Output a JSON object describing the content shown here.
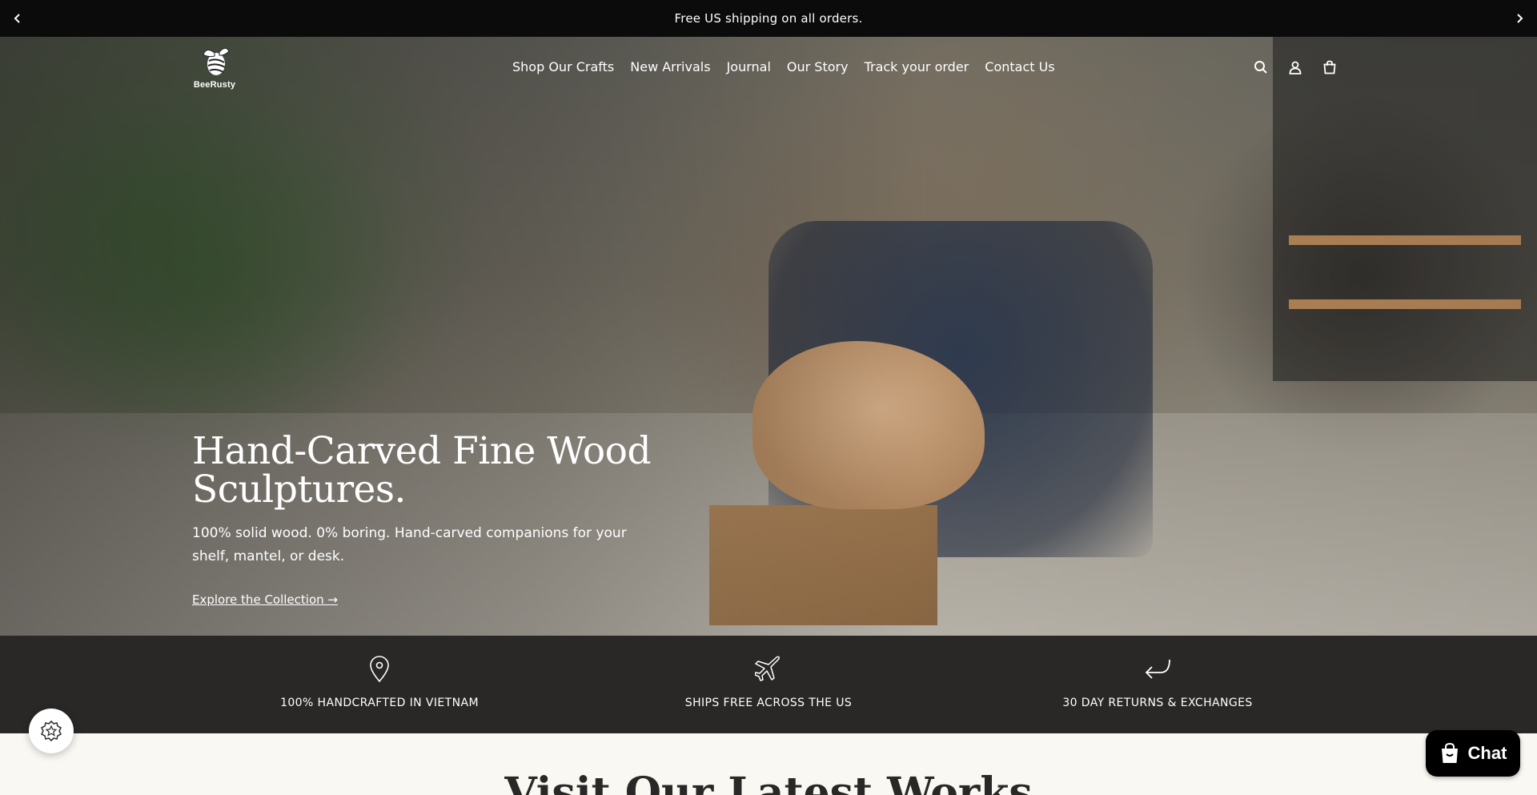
{
  "announcement": {
    "text": "Free US shipping on all orders.",
    "prev_icon": "chevron-left-icon",
    "next_icon": "chevron-right-icon"
  },
  "header": {
    "logo_text": "BeeRusty",
    "nav": [
      {
        "label": "Shop Our Crafts"
      },
      {
        "label": "New Arrivals"
      },
      {
        "label": "Journal"
      },
      {
        "label": "Our Story"
      },
      {
        "label": "Track your order"
      },
      {
        "label": "Contact Us"
      }
    ],
    "icons": [
      "search-icon",
      "account-icon",
      "cart-icon"
    ]
  },
  "hero": {
    "title": "Hand-Carved Fine Wood Sculptures.",
    "subtitle": "100% solid wood. 0% boring. Hand-carved companions for your shelf, mantel, or desk.",
    "cta": "Explore the Collection →"
  },
  "features": [
    {
      "label": "100% HANDCRAFTED IN VIETNAM",
      "icon": "map-pin-icon"
    },
    {
      "label": "SHIPS FREE ACROSS THE US",
      "icon": "plane-icon"
    },
    {
      "label": "30 DAY RETURNS & EXCHANGES",
      "icon": "return-arrow-icon"
    }
  ],
  "latest": {
    "title": "Visit Our Latest Works"
  },
  "chat": {
    "label": "Chat"
  },
  "colors": {
    "announcement_bg": "#0b0b0b",
    "features_bg": "#2a2826",
    "page_bg": "#faf8f3",
    "chat_bg": "#000000"
  }
}
